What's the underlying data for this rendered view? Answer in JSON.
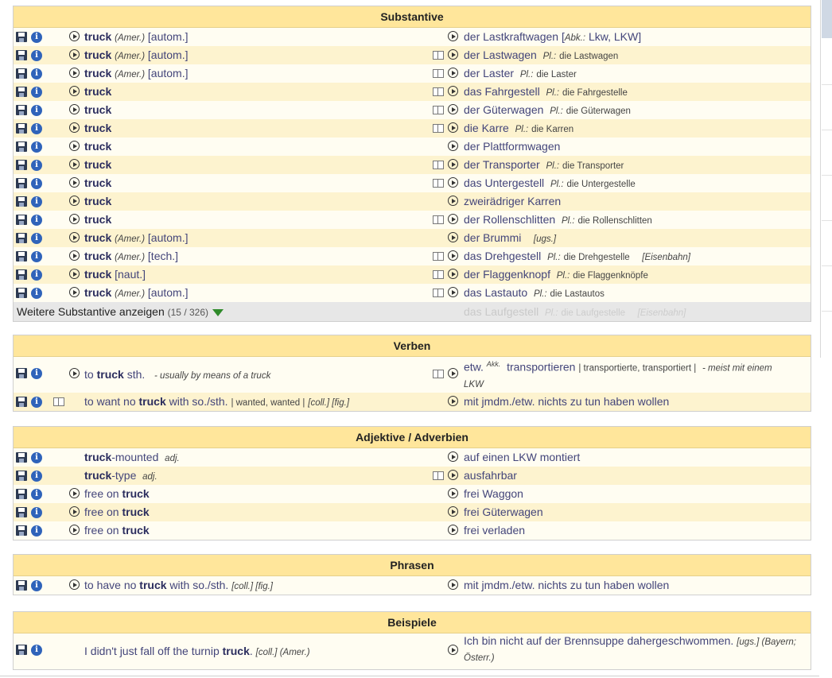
{
  "sections": {
    "substantive": {
      "title": "Substantive",
      "rows": [
        {
          "left": "truck",
          "left_tag": "(Amer.)",
          "left_domain": "[autom.]",
          "right": "der Lastkraftwagen",
          "right_extra": "[",
          "right_abbr": "Abk.:",
          "right_abbr_val": "Lkw, LKW]"
        },
        {
          "left": "truck",
          "left_tag": "(Amer.)",
          "left_domain": "[autom.]",
          "right": "der Lastwagen",
          "plural_label": "Pl.:",
          "plural": "die Lastwagen"
        },
        {
          "left": "truck",
          "left_tag": "(Amer.)",
          "left_domain": "[autom.]",
          "right": "der Laster",
          "plural_label": "Pl.:",
          "plural": "die Laster"
        },
        {
          "left": "truck",
          "right": "das Fahrgestell",
          "plural_label": "Pl.:",
          "plural": "die Fahrgestelle"
        },
        {
          "left": "truck",
          "right": "der Güterwagen",
          "plural_label": "Pl.:",
          "plural": "die Güterwagen"
        },
        {
          "left": "truck",
          "right": "die Karre",
          "plural_label": "Pl.:",
          "plural": "die Karren"
        },
        {
          "left": "truck",
          "right": "der Plattformwagen"
        },
        {
          "left": "truck",
          "right": "der Transporter",
          "plural_label": "Pl.:",
          "plural": "die Transporter"
        },
        {
          "left": "truck",
          "right": "das Untergestell",
          "plural_label": "Pl.:",
          "plural": "die Untergestelle"
        },
        {
          "left": "truck",
          "right": "zweirädriger Karren"
        },
        {
          "left": "truck",
          "right": "der Rollenschlitten",
          "plural_label": "Pl.:",
          "plural": "die Rollenschlitten"
        },
        {
          "left": "truck",
          "left_tag": "(Amer.)",
          "left_domain": "[autom.]",
          "right": "der Brummi",
          "right_tag": "[ugs.]"
        },
        {
          "left": "truck",
          "left_tag": "(Amer.)",
          "left_domain": "[tech.]",
          "right": "das Drehgestell",
          "plural_label": "Pl.:",
          "plural": "die Drehgestelle",
          "right_tag": "[Eisenbahn]"
        },
        {
          "left": "truck",
          "left_domain": "[naut.]",
          "right": "der Flaggenknopf",
          "plural_label": "Pl.:",
          "plural": "die Flaggenknöpfe"
        },
        {
          "left": "truck",
          "left_tag": "(Amer.)",
          "left_domain": "[autom.]",
          "right": "das Lastauto",
          "plural_label": "Pl.:",
          "plural": "die Lastautos"
        }
      ],
      "more_label": "Weitere Substantive anzeigen",
      "more_count": "(15 / 326)",
      "ghost": "das Laufgestell",
      "ghost_plural_label": "Pl.:",
      "ghost_plural": "die Laufgestelle",
      "ghost_tag": "[Eisenbahn]"
    },
    "verben": {
      "title": "Verben",
      "r1_left_a": "to",
      "r1_left_b": "truck",
      "r1_left_c": "sth.",
      "r1_left_note": "- usually by means of a truck",
      "r1_right_a": "etw.",
      "r1_right_akk": "Akk.",
      "r1_right_b": "transportieren",
      "r1_right_forms": "| transportierte, transportiert |",
      "r1_right_note": "- meist mit einem",
      "r1_right_note2": "LKW",
      "r2_left_a": "to want no",
      "r2_left_b": "truck",
      "r2_left_c": "with so./sth.",
      "r2_left_forms": "| wanted, wanted |",
      "r2_left_tags": "[coll.] [fig.]",
      "r2_right": "mit jmdm./etw. nichts zu tun haben wollen"
    },
    "adjektive": {
      "title": "Adjektive / Adverbien",
      "r1_left_b": "truck",
      "r1_left_c": "-mounted",
      "r1_left_tag": "adj.",
      "r1_right": "auf einen LKW montiert",
      "r2_left_b": "truck",
      "r2_left_c": "-type",
      "r2_left_tag": "adj.",
      "r2_right": "ausfahrbar",
      "r3_left_a": "free on",
      "r3_left_b": "truck",
      "r3_right": "frei Waggon",
      "r4_left_a": "free on",
      "r4_left_b": "truck",
      "r4_right": "frei Güterwagen",
      "r5_left_a": "free on",
      "r5_left_b": "truck",
      "r5_right": "frei verladen"
    },
    "phrasen": {
      "title": "Phrasen",
      "left_a": "to have no",
      "left_b": "truck",
      "left_c": "with so./sth.",
      "left_tags": "[coll.] [fig.]",
      "right": "mit jmdm./etw. nichts zu tun haben wollen"
    },
    "beispiele": {
      "title": "Beispiele",
      "left_a": "I didn't just fall off the turnip",
      "left_b": "truck",
      "left_c": ".",
      "left_tags": "[coll.] (Amer.)",
      "right_a": "Ich bin nicht auf der Brennsuppe dahergeschwommen.",
      "right_tags": "[ugs.] (Bayern;",
      "right_tags2": "Österr.)"
    }
  },
  "icons": {
    "save": "save-icon",
    "info": "info-icon",
    "play": "play-audio-icon",
    "book": "conjugation-book-icon",
    "more": "expand-arrow-icon"
  },
  "colors": {
    "header": "#ffe69b",
    "row_alt": "#fdf3cf",
    "row": "#fffdf2",
    "text": "#43457a",
    "arrow": "#2f8a2a"
  }
}
